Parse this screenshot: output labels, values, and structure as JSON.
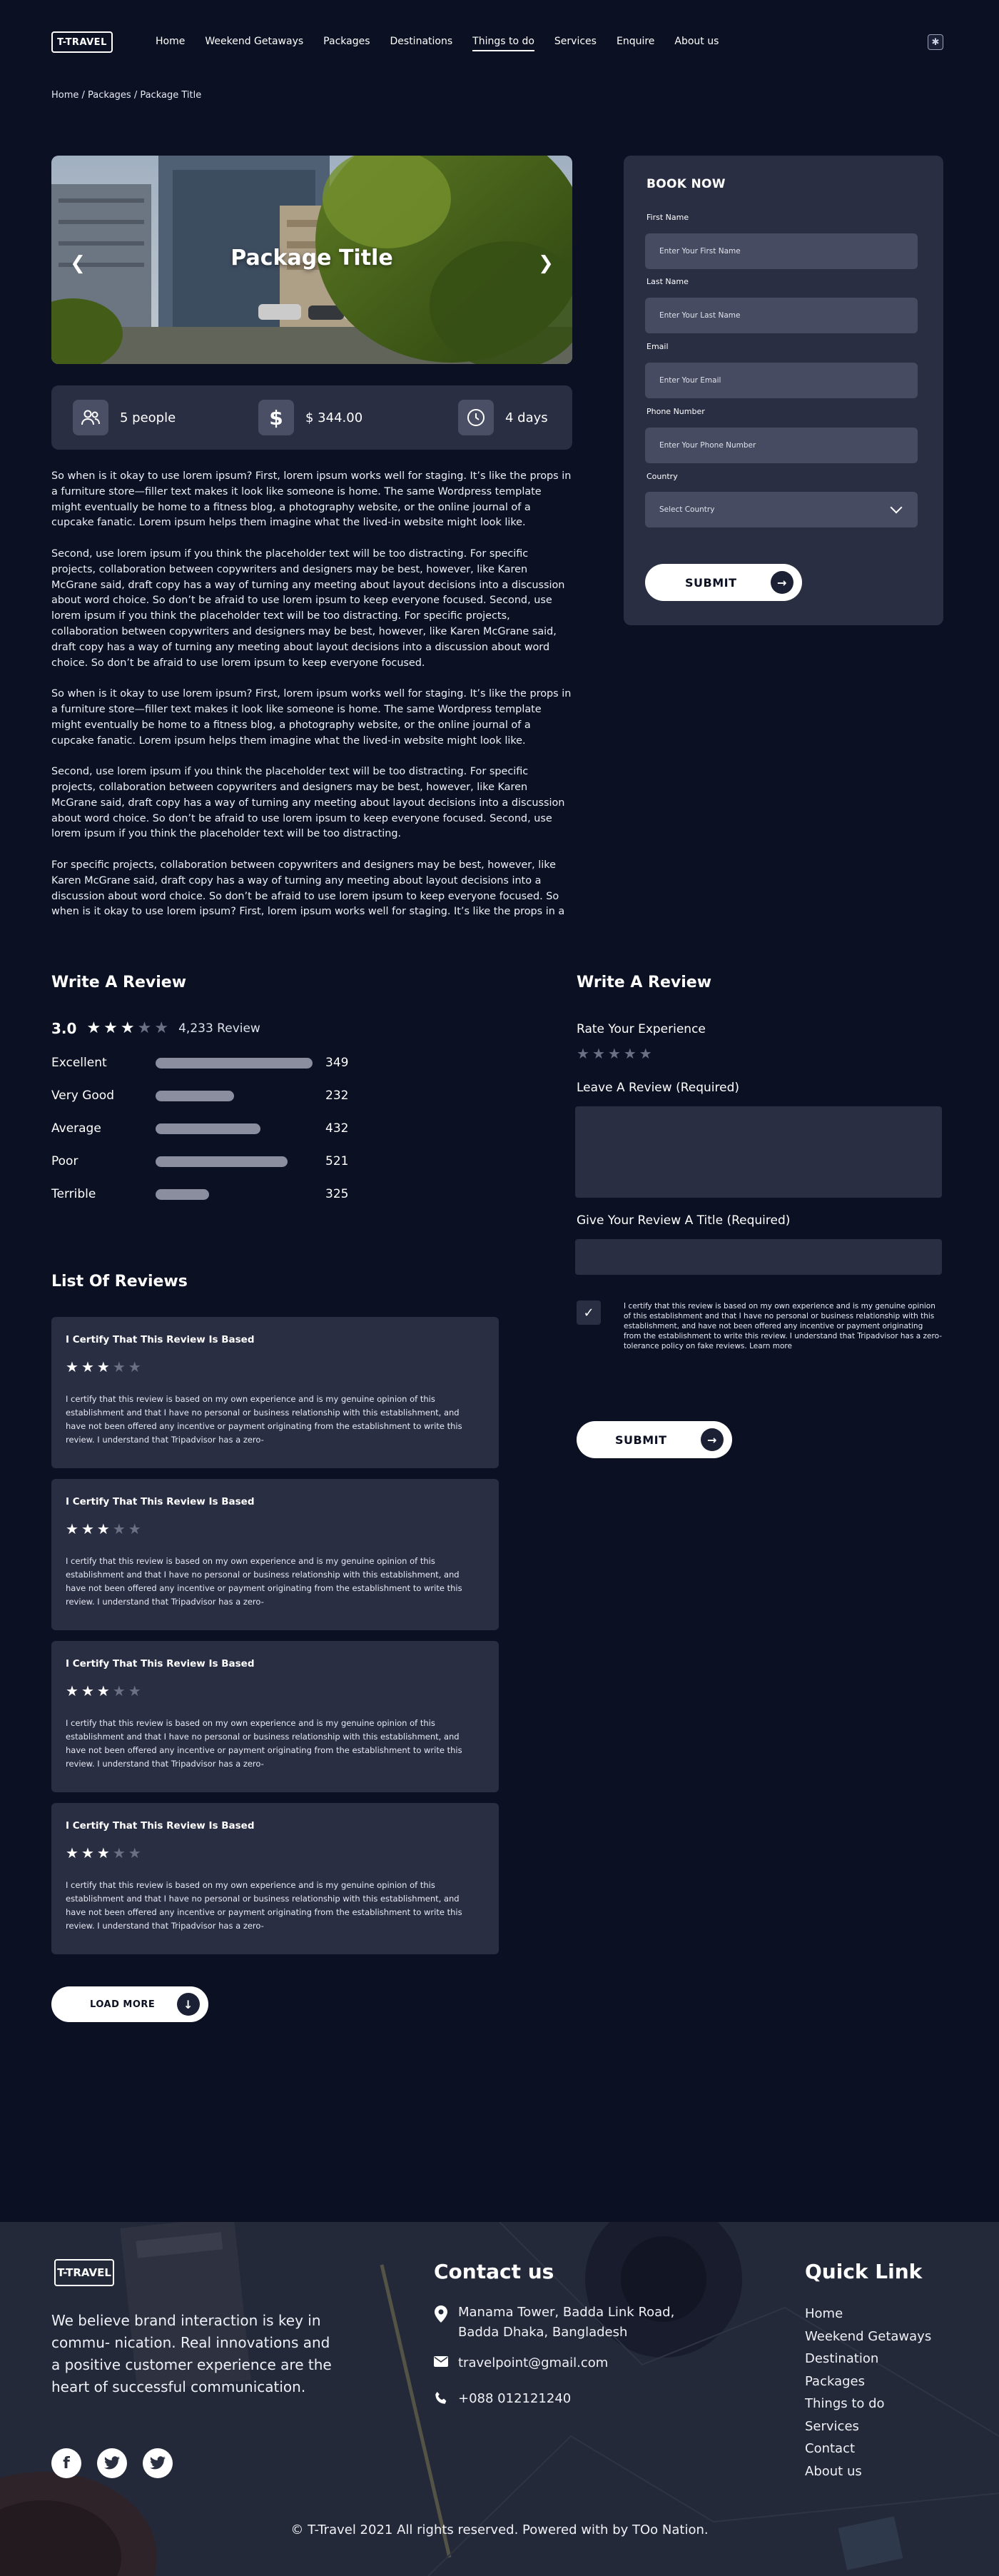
{
  "header": {
    "logo": "T-TRAVEL",
    "nav": [
      "Home",
      "Weekend Getaways",
      "Packages",
      "Destinations",
      "Things to do",
      "Services",
      "Enquire",
      "About us"
    ],
    "active_nav": "Things to do",
    "breadcrumb": "Home  / Packages / Package Title"
  },
  "hero": {
    "title": "Package Title",
    "prev": "❮",
    "next": "❯"
  },
  "stats": {
    "people": "5 people",
    "price": "$ 344.00",
    "duration": "4 days"
  },
  "description": [
    "So when is it okay to use lorem ipsum? First, lorem ipsum works well for staging. It’s like the props in a furniture store—filler text makes it look like someone is home. The same Wordpress template might eventually be home to a fitness blog, a photography website, or the online journal of a cupcake fanatic. Lorem ipsum helps them imagine what the lived-in website might look like.",
    "Second, use lorem ipsum if you think the placeholder text will be too distracting. For specific projects, collaboration between copywriters and designers may be best, however, like Karen McGrane said, draft copy has a way of turning any meeting about layout decisions into a discussion about word choice. So don’t be afraid to use lorem ipsum to keep everyone focused. Second, use lorem ipsum if you think the placeholder text will be too distracting. For specific projects, collaboration between copywriters and designers may be best, however, like Karen McGrane said, draft copy has a way of turning any meeting about layout decisions into a discussion about word choice. So don’t be afraid to use lorem ipsum to keep everyone focused.",
    "So when is it okay to use lorem ipsum? First, lorem ipsum works well for staging. It’s like the props in a furniture store—filler text makes it look like someone is home. The same Wordpress template might eventually be home to a fitness blog, a photography website, or the online journal of a cupcake fanatic. Lorem ipsum helps them imagine what the lived-in website might look like.",
    "Second, use lorem ipsum if you think the placeholder text will be too distracting. For specific projects, collaboration between copywriters and designers may be best, however, like Karen McGrane said, draft copy has a way of turning any meeting about layout decisions into a discussion about word choice. So don’t be afraid to use lorem ipsum to keep everyone focused. Second, use lorem ipsum if you think the placeholder text will be too distracting.",
    " For specific projects, collaboration between copywriters and designers may be best, however, like Karen McGrane said, draft copy has a way of turning any meeting about layout decisions into a discussion about word choice. So don’t be afraid to use lorem ipsum to keep everyone focused. So when is it okay to use lorem ipsum? First, lorem ipsum works well for staging. It’s like the props in a furniture store—filler text makes it look like someone is home. The same Wordpress template might eventually be home to a fitness blog, a photography website, or the online journal of a"
  ],
  "booking": {
    "title": "BOOK NOW",
    "first_name_label": "First Name",
    "first_name_placeholder": "Enter Your First Name",
    "last_name_label": "Last Name",
    "last_name_placeholder": "Enter Your Last Name",
    "email_label": "Email",
    "email_placeholder": "Enter Your Email",
    "phone_label": "Phone Number",
    "phone_placeholder": "Enter Your Phone Number",
    "country_label": "Country",
    "country_value": "Select Country",
    "submit": "SUBMIT"
  },
  "review_summary": {
    "title": "Write A Review",
    "score": "3.0",
    "score_stars": 3,
    "count": "4,233 Review",
    "rows": [
      {
        "label": "Excellent",
        "value": "349",
        "level": 1.0
      },
      {
        "label": "Very Good",
        "value": "232",
        "level": 0.5
      },
      {
        "label": "Average",
        "value": "432",
        "level": 0.67
      },
      {
        "label": "Poor",
        "value": "521",
        "level": 0.84
      },
      {
        "label": "Terrible",
        "value": "325",
        "level": 0.34
      }
    ]
  },
  "review_form": {
    "title": "Write A Review",
    "rate_label": "Rate Your Experience",
    "leave_label": "Leave A Review (Required)",
    "title_label": "Give Your Review A Title (Required)",
    "certify": "I certify that this review is based on my own experience and is my genuine opinion of this establishment and that I have no personal or business relationship with this establishment, and have not been offered any incentive or payment originating from the establishment to write this review. I understand that Tripadvisor has a zero-tolerance policy on fake reviews. Learn more",
    "submit": "SUBMIT"
  },
  "reviews": {
    "title": "List Of Reviews",
    "items": [
      {
        "title": "I Certify That This Review Is Based",
        "stars": 3,
        "body": "I certify that this review is based on my own experience and is my genuine opinion of this establishment and that I have no personal or business relationship with this establishment, and have not been offered any incentive or payment originating from the establishment to write this review. I understand that Tripadvisor has a zero-"
      },
      {
        "title": "I Certify That This Review Is Based",
        "stars": 3,
        "body": "I certify that this review is based on my own experience and is my genuine opinion of this establishment and that I have no personal or business relationship with this establishment, and have not been offered any incentive or payment originating from the establishment to write this review. I understand that Tripadvisor has a zero-"
      },
      {
        "title": "I Certify That This Review Is Based",
        "stars": 3,
        "body": "I certify that this review is based on my own experience and is my genuine opinion of this establishment and that I have no personal or business relationship with this establishment, and have not been offered any incentive or payment originating from the establishment to write this review. I understand that Tripadvisor has a zero-"
      },
      {
        "title": "I Certify That This Review Is Based",
        "stars": 3,
        "body": "I certify that this review is based on my own experience and is my genuine opinion of this establishment and that I have no personal or business relationship with this establishment, and have not been offered any incentive or payment originating from the establishment to write this review. I understand that Tripadvisor has a zero-"
      }
    ],
    "load_more": "LOAD MORE"
  },
  "footer": {
    "logo": "T-TRAVEL",
    "tagline": "We believe brand interaction is key in commu- nication. Real innovations and a positive customer experience are the heart of successful communication.",
    "contact_title": "Contact us",
    "address": "Manama Tower, Badda Link Road, Badda Dhaka, Bangladesh",
    "email": "travelpoint@gmail.com",
    "phone": "+088 012121240",
    "quick_title": "Quick Link",
    "quick_links": [
      "Home",
      "Weekend Getaways",
      "Destination",
      "Packages",
      "Things to do",
      "Services",
      "Contact",
      "About us"
    ],
    "copyright": "© T-Travel 2021 All rights reserved. Powered with  by TOo Nation."
  },
  "colors": {
    "page_bg": "#0b1023",
    "panel_bg": "#2a2e43",
    "input_bg": "#474b62",
    "bar_fill": "#8a8e9e",
    "footer_bg": "#2b3040"
  }
}
